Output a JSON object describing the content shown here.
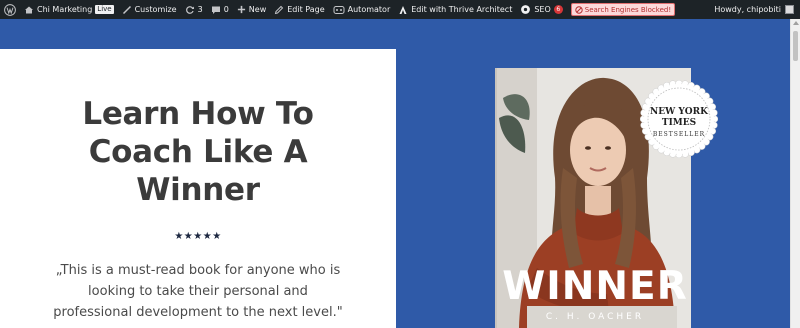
{
  "adminbar": {
    "site_name": "Chi Marketing",
    "live_badge": "Live",
    "customize": "Customize",
    "updates_count": "3",
    "comments_count": "0",
    "new": "New",
    "edit_page": "Edit Page",
    "automator": "Automator",
    "thrive": "Edit with Thrive Architect",
    "seo": "SEO",
    "seo_count": "6",
    "search_blocked": "Search Engines Blocked!",
    "howdy": "Howdy, chipobiti"
  },
  "hero": {
    "title": "Learn How To Coach Like A Winner",
    "stars": "★★★★★",
    "quote": "„This is a must-read book for anyone who is looking to take their personal and professional development to the next level.\""
  },
  "book": {
    "seal_line1": "NEW YORK",
    "seal_line2": "TIMES",
    "seal_sub": "BESTSELLER",
    "title": "WINNER",
    "author": "C. H. OACHER"
  },
  "colors": {
    "page_bg": "#2f5aa8",
    "adminbar_bg": "#1d2327",
    "card_bg": "#ffffff",
    "title_color": "#3b3b3b",
    "blocked_bg": "#fcd9da"
  }
}
